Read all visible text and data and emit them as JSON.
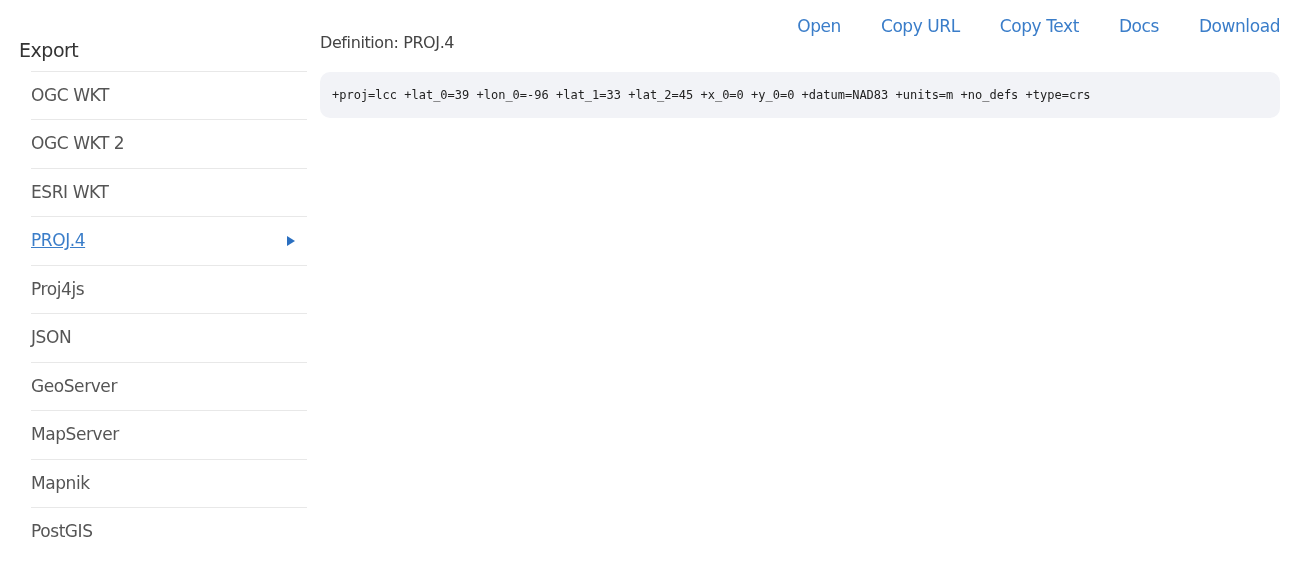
{
  "sidebar": {
    "title": "Export",
    "items": [
      {
        "label": "OGC WKT",
        "selected": false
      },
      {
        "label": "OGC WKT 2",
        "selected": false
      },
      {
        "label": "ESRI WKT",
        "selected": false
      },
      {
        "label": "PROJ.4",
        "selected": true
      },
      {
        "label": "Proj4js",
        "selected": false
      },
      {
        "label": "JSON",
        "selected": false
      },
      {
        "label": "GeoServer",
        "selected": false
      },
      {
        "label": "MapServer",
        "selected": false
      },
      {
        "label": "Mapnik",
        "selected": false
      },
      {
        "label": "PostGIS",
        "selected": false
      }
    ]
  },
  "definition": {
    "title": "Definition: PROJ.4",
    "code": "+proj=lcc +lat_0=39 +lon_0=-96 +lat_1=33 +lat_2=45 +x_0=0 +y_0=0 +datum=NAD83 +units=m +no_defs +type=crs"
  },
  "actions": [
    "Open",
    "Copy URL",
    "Copy Text",
    "Docs",
    "Download"
  ]
}
